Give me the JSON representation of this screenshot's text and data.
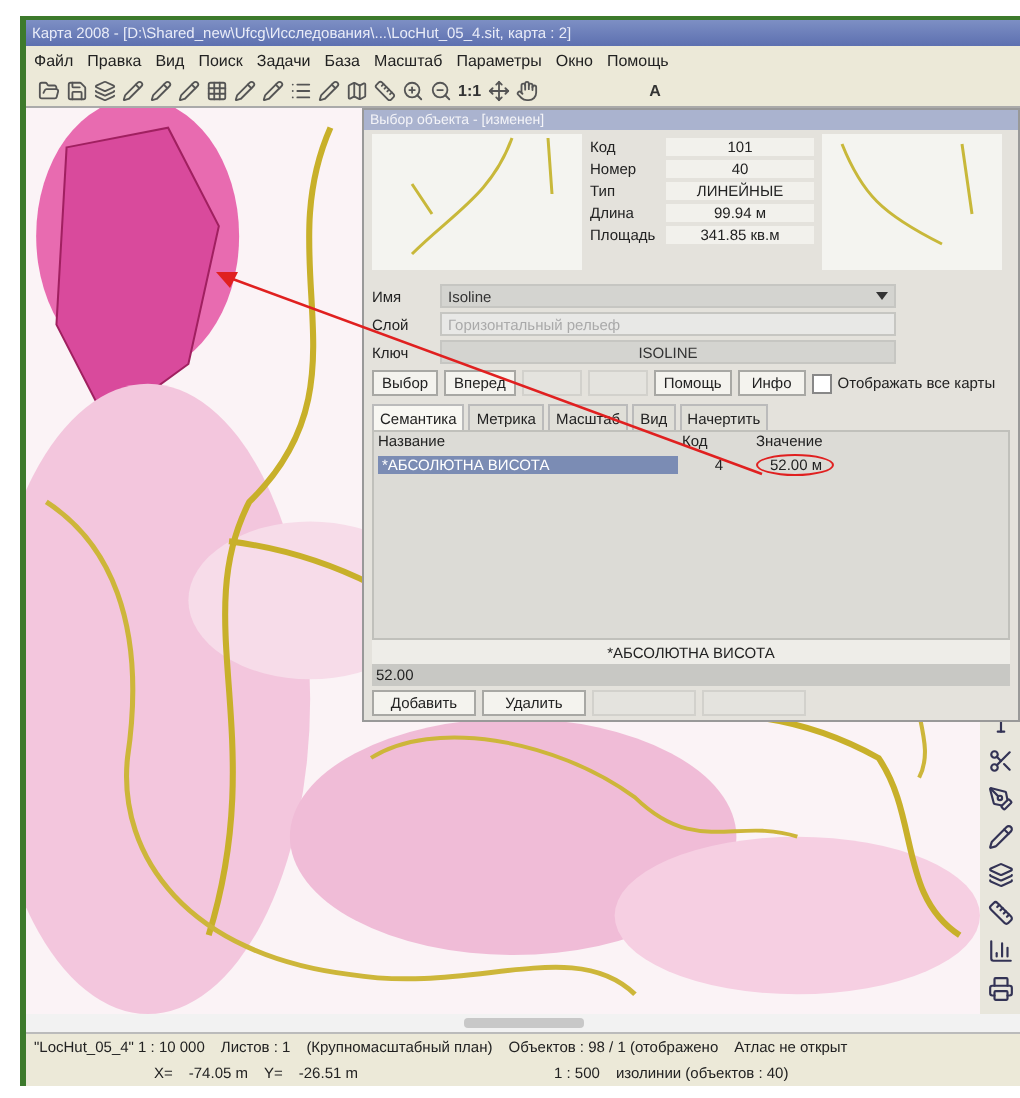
{
  "window": {
    "title": "Карта 2008 - [D:\\Shared_new\\Ufcg\\Исследования\\...\\LocHut_05_4.sit, карта : 2]"
  },
  "menu": [
    "Файл",
    "Правка",
    "Вид",
    "Поиск",
    "Задачи",
    "База",
    "Масштаб",
    "Параметры",
    "Окно",
    "Помощь"
  ],
  "toolbar": {
    "texts": [
      "1:1",
      "A"
    ]
  },
  "dialog": {
    "title": "Выбор объекта - [изменен]",
    "properties": [
      {
        "label": "Код",
        "value": "101"
      },
      {
        "label": "Номер",
        "value": "40"
      },
      {
        "label": "Тип",
        "value": "ЛИНЕЙНЫЕ"
      },
      {
        "label": "Длина",
        "value": "99.94 м"
      },
      {
        "label": "Площадь",
        "value": "341.85 кв.м"
      }
    ],
    "name": {
      "label": "Имя",
      "value": "Isoline"
    },
    "layer": {
      "label": "Слой",
      "value": "Горизонтальный рельеф",
      "disabled": true
    },
    "key": {
      "label": "Ключ",
      "value": "ISOLINE"
    },
    "buttons": [
      {
        "label": "Выбор",
        "disabled": false
      },
      {
        "label": "Вперед",
        "disabled": false
      },
      {
        "disabled": true
      },
      {
        "disabled": true
      },
      {
        "label": "Помощь",
        "disabled": false
      },
      {
        "label": "Инфо",
        "disabled": false
      }
    ],
    "show_all_maps": {
      "label": "Отображать все карты",
      "checked": false
    },
    "tabs": [
      {
        "label": "Семантика",
        "selected": true
      },
      {
        "label": "Метрика",
        "selected": false
      },
      {
        "label": "Масштаб",
        "selected": false
      },
      {
        "label": "Вид",
        "selected": false
      },
      {
        "label": "Начертить",
        "selected": false
      }
    ],
    "table": {
      "columns": [
        "Название",
        "Код",
        "Значение"
      ],
      "rows": [
        {
          "cells": [
            "*АБСОЛЮТНА ВИСОТА",
            "4",
            "52.00 м"
          ],
          "selected": true,
          "circled": true
        }
      ]
    },
    "semantic_label": "*АБСОЛЮТНА ВИСОТА",
    "semantic_value": "52.00",
    "bottom_buttons": [
      {
        "label": "Добавить",
        "disabled": false
      },
      {
        "label": "Удалить",
        "disabled": false
      },
      {
        "disabled": true
      },
      {
        "disabled": true
      }
    ]
  },
  "status_bar": {
    "line_1": [
      "\"LocHut_05_4\" 1 : 10 000",
      "Листов : 1",
      "(Крупномасштабный план)",
      "Объектов : 98 / 1 (отображено",
      "Атлас не открыт"
    ],
    "line_2": [
      "X=",
      "-74.05 m",
      "Y=",
      "-26.51 m",
      "1 : 500",
      "изолинии (объектов : 40)"
    ]
  }
}
